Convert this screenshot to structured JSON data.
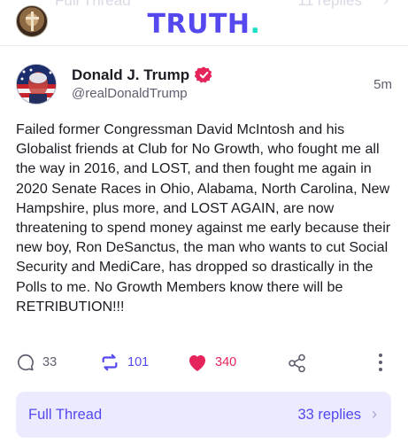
{
  "header": {
    "brand": "TRUTH",
    "brand_dot": ".",
    "ghost_left": "Full Thread",
    "ghost_right": "11 replies",
    "brand_color": "#5448ee",
    "accent_color": "#17e0c4"
  },
  "post": {
    "author_name": "Donald J. Trump",
    "handle": "@realDonaldTrump",
    "time": "5m",
    "verified_icon": "verified-badge-icon",
    "body": "Failed former Congressman David McIntosh and his Globalist friends at Club for No Growth, who fought me all the way in 2016, and LOST, and then fought me again in 2020 Senate Races in Ohio, Alabama, North Carolina, New Hampshire, plus more, and LOST AGAIN, are now threatening to spend money against me early because their new boy, Ron DeSanctus, the man who wants to cut Social Security and MediCare, has dropped so drastically in the Polls to me. No Growth Members know there will be RETRIBUTION!!!"
  },
  "actions": {
    "replies": "33",
    "retruths": "101",
    "likes": "340",
    "like_color": "#e5245c",
    "retruth_color": "#5448ee"
  },
  "thread_bar": {
    "label": "Full Thread",
    "replies": "33 replies",
    "chevron": "›"
  }
}
